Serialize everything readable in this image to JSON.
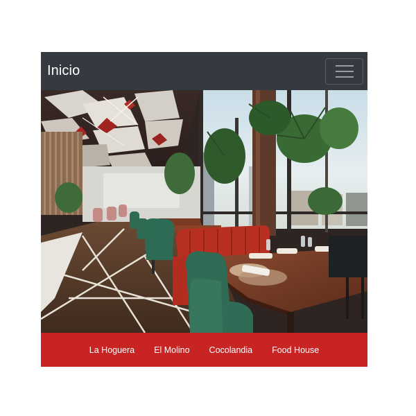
{
  "navbar": {
    "brand": "Inicio",
    "toggler_icon": "hamburger-menu-icon",
    "background": "#343a40"
  },
  "hero": {
    "alt": "Restaurant interior"
  },
  "footer_nav": {
    "background": "#c82424",
    "links": [
      {
        "label": "La Hoguera"
      },
      {
        "label": "El Molino"
      },
      {
        "label": "Cocolandia"
      },
      {
        "label": "Food House"
      }
    ]
  }
}
